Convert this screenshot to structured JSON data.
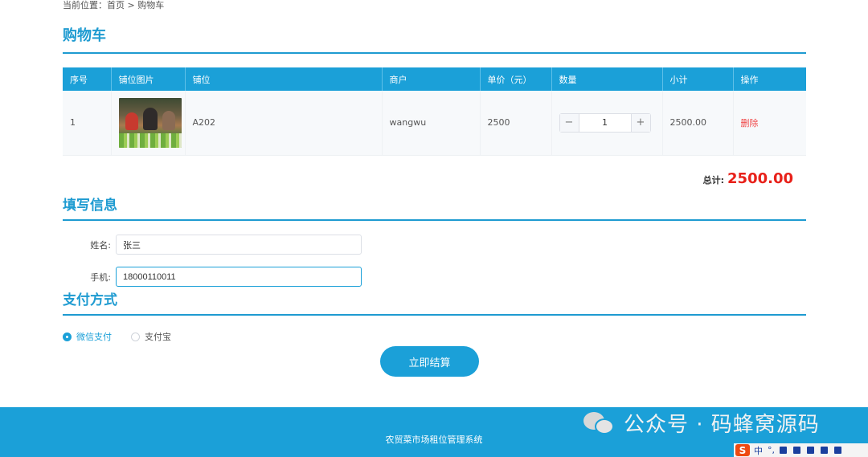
{
  "breadcrumb": {
    "prefix": "当前位置：",
    "home": "首页",
    "sep": " > ",
    "current": "购物车"
  },
  "cart": {
    "title": "购物车",
    "columns": [
      "序号",
      "铺位图片",
      "铺位",
      "商户",
      "单价（元）",
      "数量",
      "小计",
      "操作"
    ],
    "rows": [
      {
        "index": "1",
        "stall": "A202",
        "merchant": "wangwu",
        "price": "2500",
        "quantity": "1",
        "subtotal": "2500.00",
        "action": "删除"
      }
    ],
    "stepper_minus": "−",
    "stepper_plus": "+",
    "total_label": "总计:",
    "total_value": "2500.00"
  },
  "info": {
    "title": "填写信息",
    "name_label": "姓名:",
    "name_value": "张三",
    "phone_label": "手机:",
    "phone_value": "18000110011"
  },
  "payment": {
    "title": "支付方式",
    "options": [
      {
        "label": "微信支付",
        "selected": true
      },
      {
        "label": "支付宝",
        "selected": false
      }
    ]
  },
  "checkout_label": "立即结算",
  "footer": {
    "text": "农贸菜市场租位管理系统"
  },
  "watermark": {
    "text": "公众号 · 码蜂窝源码"
  },
  "ime": {
    "logo": "S",
    "mode": "中",
    "punct": "°,"
  },
  "colors": {
    "accent": "#1ba0d8",
    "danger": "#e8211a",
    "footer": "#1ba0d8"
  }
}
